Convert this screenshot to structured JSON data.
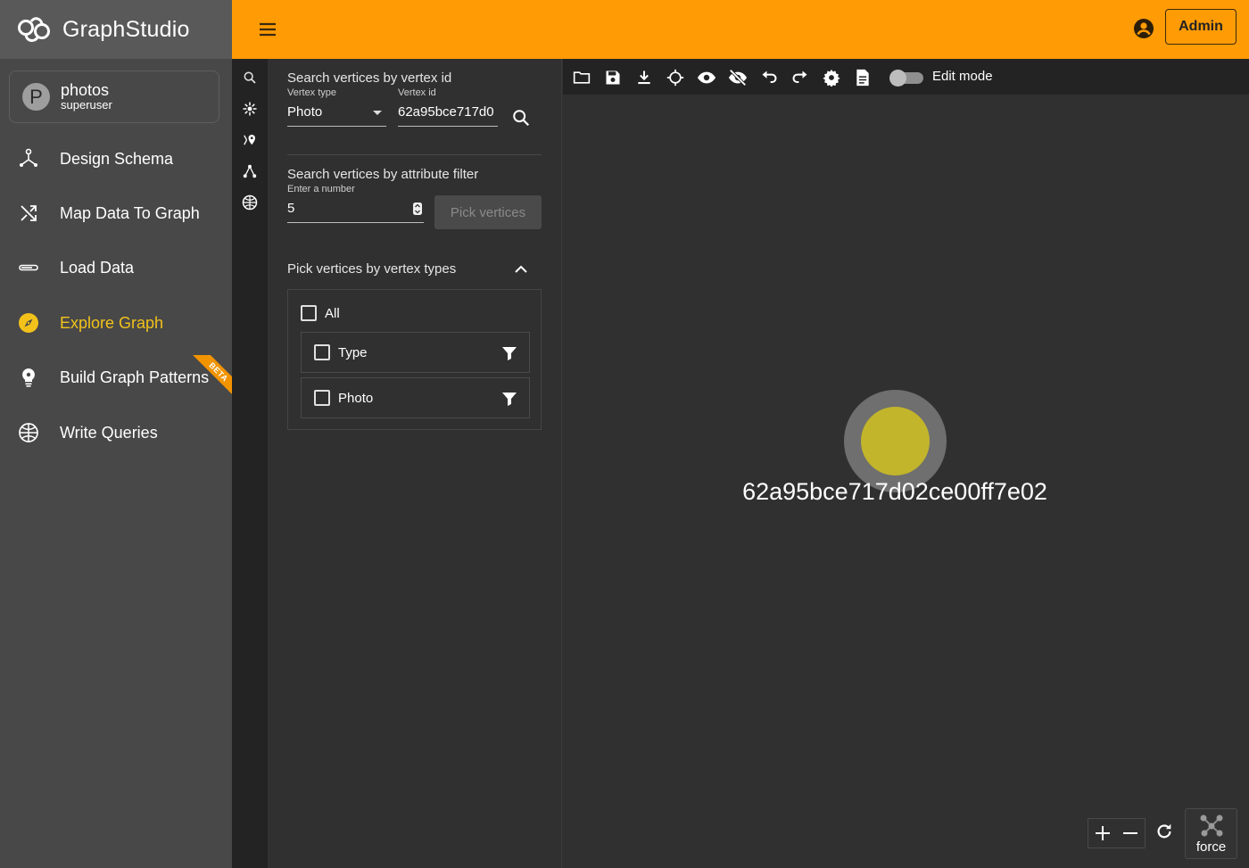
{
  "app": {
    "logo_text_main": "Graph",
    "logo_text_sub": "Studio",
    "admin_label": "Admin"
  },
  "graph": {
    "avatar_letter": "P",
    "name": "photos",
    "role": "superuser"
  },
  "nav": {
    "items": [
      {
        "label": "Design Schema",
        "icon": "schema-icon"
      },
      {
        "label": "Map Data To Graph",
        "icon": "shuffle-icon"
      },
      {
        "label": "Load Data",
        "icon": "load-data-icon"
      },
      {
        "label": "Explore Graph",
        "icon": "compass-icon",
        "active": true
      },
      {
        "label": "Build Graph Patterns",
        "icon": "lightbulb-icon",
        "badge": "BETA"
      },
      {
        "label": "Write Queries",
        "icon": "globe-query-icon"
      }
    ]
  },
  "search_panel": {
    "by_id": {
      "title": "Search vertices by vertex id",
      "vertex_type_label": "Vertex type",
      "vertex_type_value": "Photo",
      "vertex_id_label": "Vertex id",
      "vertex_id_value": "62a95bce717d0"
    },
    "by_attribute": {
      "title": "Search vertices by attribute filter",
      "number_label": "Enter a number",
      "number_value": "5",
      "pick_button": "Pick vertices"
    },
    "by_type": {
      "title": "Pick vertices by vertex types",
      "all_label": "All",
      "types": [
        "Type",
        "Photo"
      ]
    }
  },
  "canvas": {
    "edit_mode_label": "Edit mode",
    "node_label": "62a95bce717d02ce00ff7e02",
    "node_color": "#c2b52b",
    "layout_label": "force"
  },
  "colors": {
    "header": "#ff9b04",
    "accent_active": "#f2c21b",
    "sidebar": "#484848",
    "canvas": "#303030"
  }
}
